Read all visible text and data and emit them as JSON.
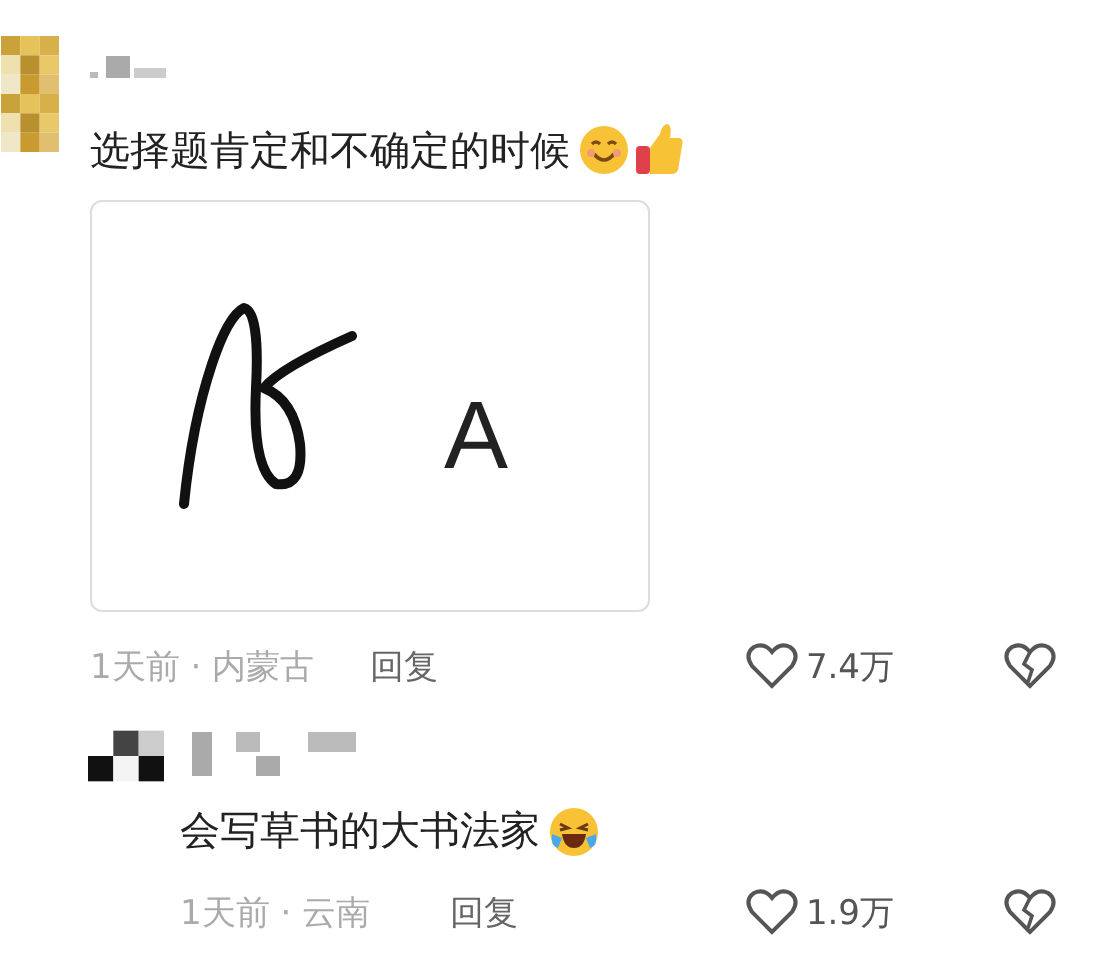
{
  "comments": [
    {
      "text": "选择题肯定和不确定的时候",
      "emojis": [
        {
          "kind": "smile"
        },
        {
          "kind": "thumbs-up"
        }
      ],
      "attachment": {
        "kind": "sketch",
        "letter": "A"
      },
      "time_location": "1天前 · 内蒙古",
      "reply_label": "回复",
      "likes": "7.4万",
      "is_reply": false
    },
    {
      "text": "会写草书的大书法家",
      "emojis": [
        {
          "kind": "laugh"
        }
      ],
      "time_location": "1天前 · 云南",
      "reply_label": "回复",
      "likes": "1.9万",
      "is_reply": true
    }
  ]
}
